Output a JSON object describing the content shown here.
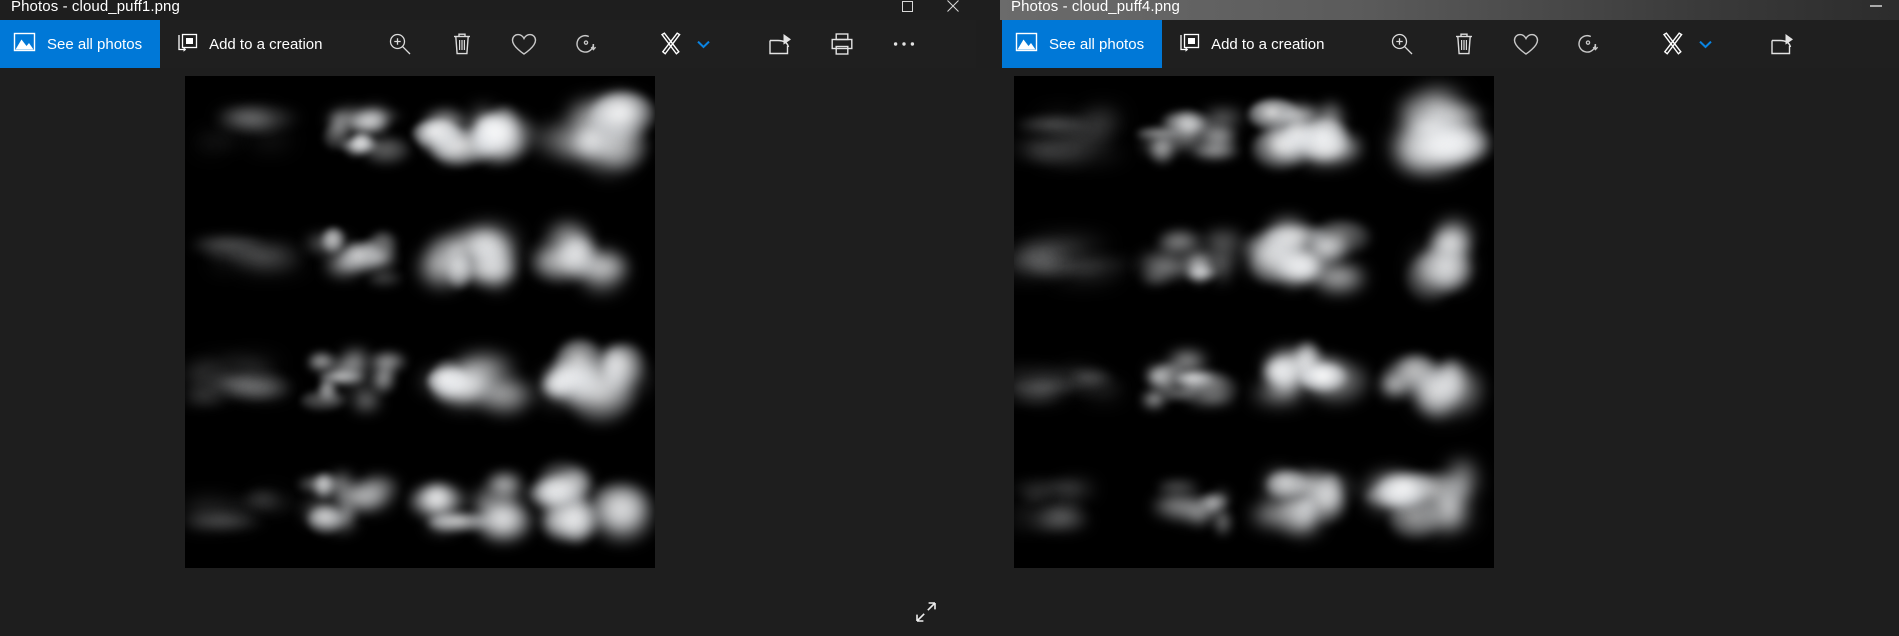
{
  "windows": [
    {
      "id": "left",
      "title": "Photos - cloud_puff1.png",
      "toolbar": {
        "see_all_photos": "See all photos",
        "add_to_creation": "Add to a creation",
        "icons": [
          {
            "name": "zoom-in-icon",
            "label": "Zoom"
          },
          {
            "name": "delete-icon",
            "label": "Delete"
          },
          {
            "name": "heart-icon",
            "label": "Add to favorites"
          },
          {
            "name": "rotate-icon",
            "label": "Rotate"
          },
          {
            "name": "edit-create-icon",
            "label": "Edit & Create"
          },
          {
            "name": "chevron-down-icon",
            "label": "More edit options"
          },
          {
            "name": "share-icon",
            "label": "Share"
          },
          {
            "name": "print-icon",
            "label": "Print"
          },
          {
            "name": "more-options-icon",
            "label": "See more"
          }
        ]
      },
      "window_controls": [
        {
          "name": "maximize-button",
          "label": "Maximize"
        },
        {
          "name": "close-button",
          "label": "Close"
        }
      ],
      "bottom": {
        "fullscreen_label": "Enter fullscreen"
      },
      "image": {
        "name": "cloud_puff1.png",
        "background": "#000000",
        "columns": 4,
        "rows": 4
      }
    },
    {
      "id": "right",
      "title": "Photos - cloud_puff4.png",
      "toolbar": {
        "see_all_photos": "See all photos",
        "add_to_creation": "Add to a creation",
        "icons": [
          {
            "name": "zoom-in-icon",
            "label": "Zoom"
          },
          {
            "name": "delete-icon",
            "label": "Delete"
          },
          {
            "name": "heart-icon",
            "label": "Add to favorites"
          },
          {
            "name": "rotate-icon",
            "label": "Rotate"
          },
          {
            "name": "edit-create-icon",
            "label": "Edit & Create"
          },
          {
            "name": "chevron-down-icon",
            "label": "More edit options"
          },
          {
            "name": "share-icon",
            "label": "Share"
          }
        ]
      },
      "window_controls": [
        {
          "name": "minimize-button",
          "label": "Minimize"
        }
      ],
      "image": {
        "name": "cloud_puff4.png",
        "background": "#000000",
        "columns": 4,
        "rows": 4
      }
    }
  ],
  "colors": {
    "accent": "#0078d7",
    "accent_bright": "#0a84e2",
    "chrome": "#1f1f1f",
    "app_background": "#1e1e1e",
    "photo_background": "#000000",
    "text": "#ffffff"
  }
}
